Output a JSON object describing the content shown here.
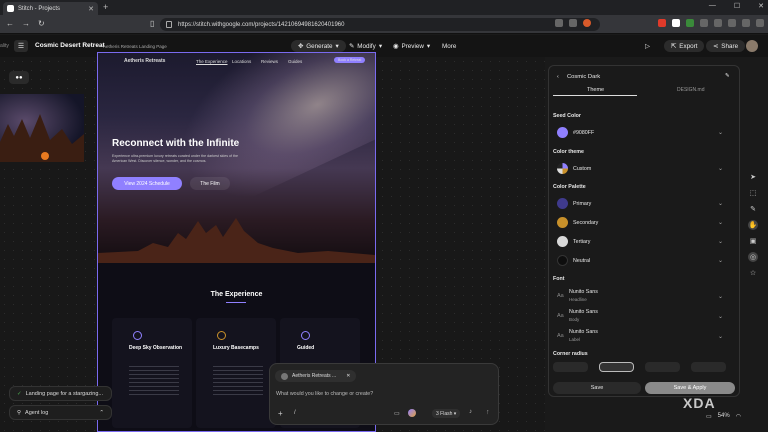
{
  "browser": {
    "tab_title": "Stitch - Projects",
    "url": "https://stitch.withgoogle.com/projects/14210694981620401960"
  },
  "header": {
    "left_trunc": "ality",
    "project_title": "Cosmic Desert Retreat",
    "screen_label": "Aetheris Retreats Landing Page",
    "generate": "Generate",
    "modify": "Modify",
    "preview": "Preview",
    "more": "More",
    "export": "Export",
    "share": "Share"
  },
  "preview": {
    "brand": "Aetheris Retreats",
    "nav": [
      "The Experience",
      "Locations",
      "Reviews",
      "Guides"
    ],
    "nav_cta": "Book a Retreat",
    "hero_title": "Reconnect with the Infinite",
    "hero_sub": "Experience ultra-premium luxury retreats curated under the darkest skies of the American West. Discover silence, wonder, and the cosmos.",
    "cta_primary": "View 2024 Schedule",
    "cta_secondary": "The Film",
    "section_title": "The Experience",
    "cards": [
      {
        "title": "Deep Sky Observation"
      },
      {
        "title": "Luxury Basecamps"
      },
      {
        "title": "Guided"
      }
    ]
  },
  "widgets": {
    "task": "Landing page for a stargazing...",
    "agent_log": "Agent log"
  },
  "prompt": {
    "chip": "Aetheris Retreats ...",
    "placeholder": "What would you like to change or create?",
    "model": "3 Flash"
  },
  "panel": {
    "title": "Cosmic Dark",
    "tab_theme": "Theme",
    "tab_design": "DESIGN.md",
    "seed_label": "Seed Color",
    "seed_value": "#9080FF",
    "theme_label": "Color theme",
    "theme_value": "Custom",
    "palette_label": "Color Palette",
    "palette": [
      {
        "name": "Primary",
        "color": "#3f3a8c"
      },
      {
        "name": "Secondary",
        "color": "#c8902a"
      },
      {
        "name": "Tertiary",
        "color": "#d8d8d8"
      },
      {
        "name": "Neutral",
        "color": "#0e0e0e"
      }
    ],
    "font_label": "Font",
    "fonts": [
      {
        "name": "Nunito Sans",
        "role": "Headline"
      },
      {
        "name": "Nunito Sans",
        "role": "Body"
      },
      {
        "name": "Nunito Sans",
        "role": "Label"
      }
    ],
    "radius_label": "Corner radius",
    "save": "Save",
    "save_apply": "Save & Apply"
  },
  "system": {
    "watermark": "XDA",
    "battery": "54%"
  },
  "colors": {
    "accent": "#9080FF"
  }
}
